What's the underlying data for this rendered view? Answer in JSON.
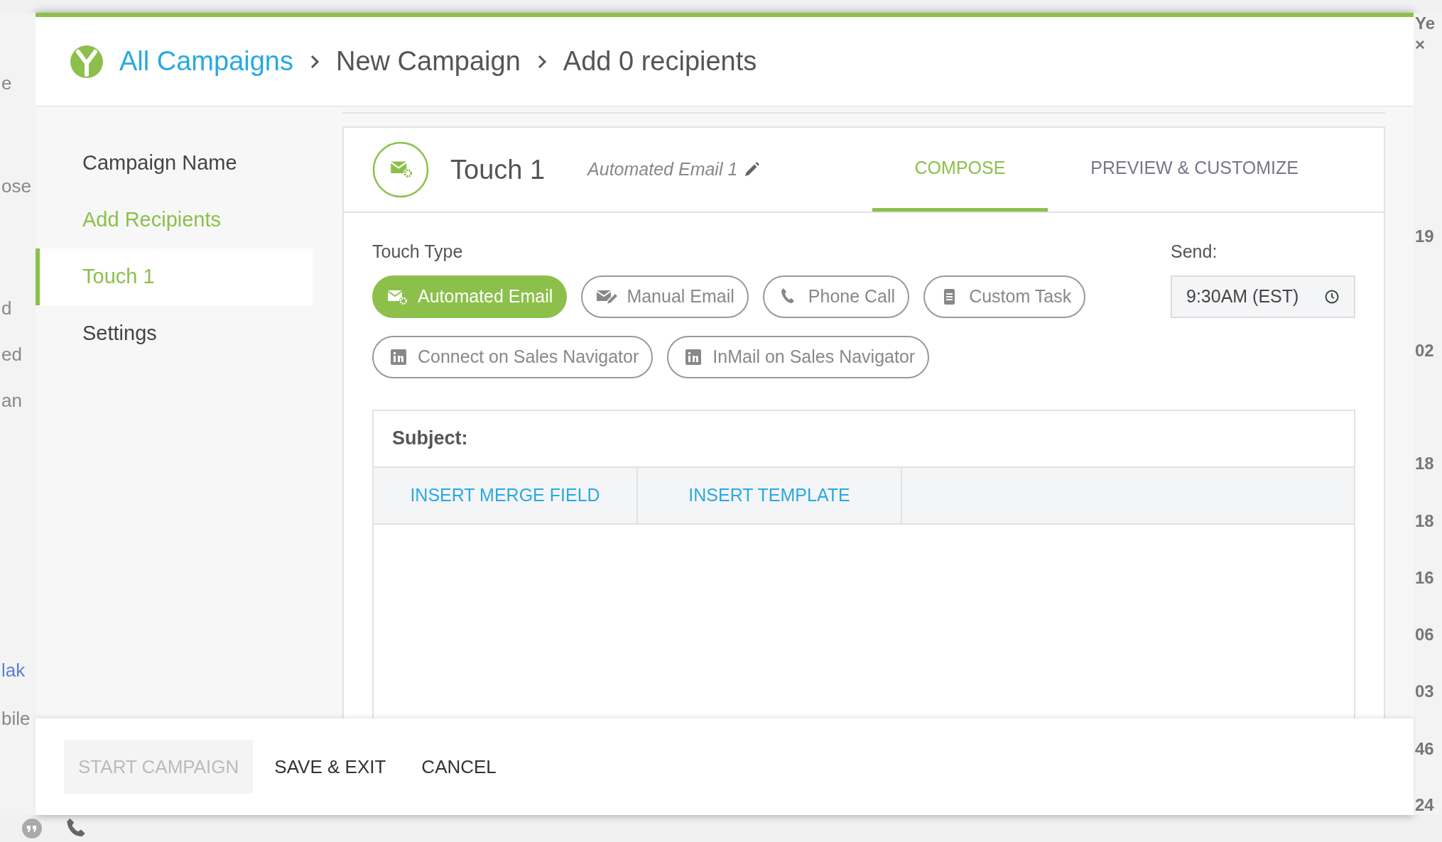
{
  "background": {
    "left_texts": [
      {
        "text": "e",
        "kind": "text"
      },
      {
        "text": "ose",
        "kind": "text"
      },
      {
        "text": "d",
        "kind": "text"
      },
      {
        "text": "ed",
        "kind": "text"
      },
      {
        "text": "an",
        "kind": "text"
      },
      {
        "text": "lak",
        "kind": "link"
      },
      {
        "text": "bile",
        "kind": "text"
      }
    ],
    "right_texts": [
      "Ye",
      "×",
      "19",
      "02",
      "18",
      "18",
      "16",
      "06",
      "03",
      "46",
      "24"
    ]
  },
  "breadcrumb": [
    {
      "text": "All Campaigns",
      "kind": "link"
    },
    {
      "text": "New Campaign",
      "kind": "text"
    },
    {
      "text": "Add 0 recipients",
      "kind": "text"
    }
  ],
  "sidebar": {
    "items": [
      {
        "label": "Campaign Name",
        "selected": false,
        "completed": false
      },
      {
        "label": "Add Recipients",
        "selected": false,
        "completed": true
      },
      {
        "label": "Touch 1",
        "selected": true,
        "completed": true
      },
      {
        "label": "Settings",
        "selected": false,
        "completed": false
      }
    ]
  },
  "touch": {
    "title": "Touch 1",
    "name": "Automated Email 1",
    "tabs": [
      {
        "label": "COMPOSE",
        "selected": true
      },
      {
        "label": "PREVIEW & CUSTOMIZE",
        "selected": false
      }
    ],
    "touch_type": {
      "label": "Touch Type",
      "options": [
        {
          "label": "Automated Email",
          "kind": "auto-email",
          "selected": true
        },
        {
          "label": "Manual Email",
          "kind": "manual-email",
          "selected": false
        },
        {
          "label": "Phone Call",
          "kind": "phone",
          "selected": false
        },
        {
          "label": "Custom Task",
          "kind": "task",
          "selected": false
        },
        {
          "label": "Connect on Sales Navigator",
          "kind": "linkedin",
          "selected": false
        },
        {
          "label": "InMail on Sales Navigator",
          "kind": "linkedin",
          "selected": false
        }
      ]
    },
    "send": {
      "label": "Send:",
      "value": "9:30AM (EST)"
    },
    "editor": {
      "subject_label": "Subject:",
      "toolbar": [
        "INSERT MERGE FIELD",
        "INSERT TEMPLATE"
      ]
    }
  },
  "footer": {
    "buttons": [
      {
        "label": "START CAMPAIGN",
        "disabled": true
      },
      {
        "label": "SAVE & EXIT",
        "disabled": false
      },
      {
        "label": "CANCEL",
        "disabled": false
      }
    ]
  }
}
